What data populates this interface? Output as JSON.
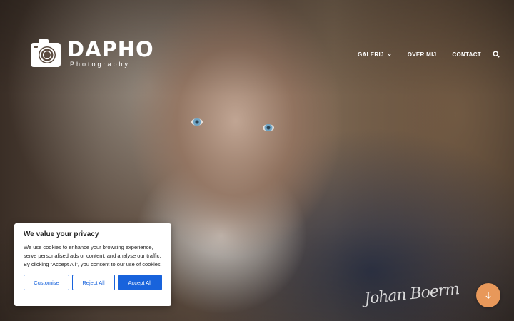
{
  "brand": {
    "name": "DAPHO",
    "tagline": "Photography"
  },
  "nav": {
    "items": [
      {
        "label": "GALERIJ"
      },
      {
        "label": "OVER MIJ"
      },
      {
        "label": "CONTACT"
      }
    ]
  },
  "signature": {
    "text": "Johan Boerm"
  },
  "cookie": {
    "title": "We value your privacy",
    "body": "We use cookies to enhance your browsing experience, serve personalised ads or content, and analyse our traffic. By clicking \"Accept All\", you consent to our use of cookies.",
    "customise_label": "Customise",
    "reject_label": "Reject All",
    "accept_label": "Accept All"
  },
  "colors": {
    "accent_blue": "#1863dc",
    "scroll_button": "#e8985a"
  },
  "icons": {
    "logo": "camera-icon",
    "dropdown": "chevron-down-icon",
    "search": "search-icon",
    "scroll": "arrow-down-icon"
  }
}
